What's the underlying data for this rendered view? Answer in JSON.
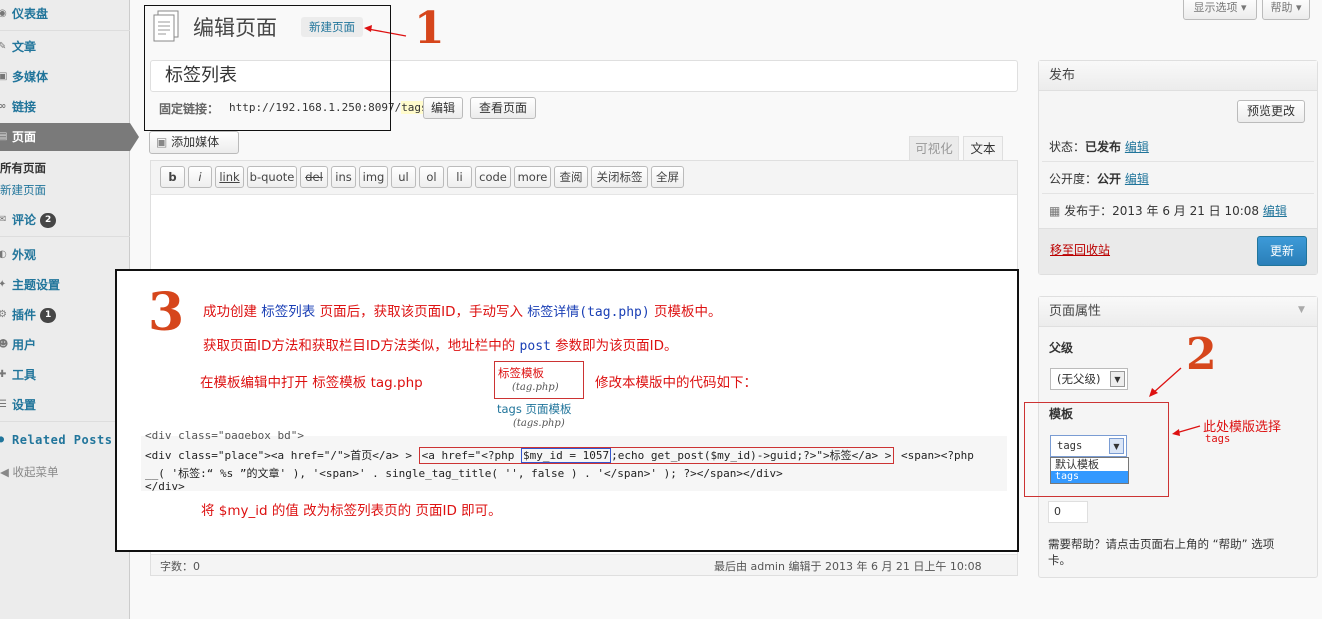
{
  "sidebar": {
    "items": [
      {
        "label": "仪表盘",
        "icon": "dashboard-icon"
      },
      {
        "label": "文章",
        "icon": "posts-icon"
      },
      {
        "label": "多媒体",
        "icon": "media-icon"
      },
      {
        "label": "链接",
        "icon": "links-icon"
      },
      {
        "label": "页面",
        "icon": "pages-icon"
      },
      {
        "label": "评论",
        "icon": "comments-icon",
        "badge": "2"
      },
      {
        "label": "外观",
        "icon": "appearance-icon"
      },
      {
        "label": "主题设置",
        "icon": "theme-settings-icon"
      },
      {
        "label": "插件",
        "icon": "plugins-icon",
        "badge": "1"
      },
      {
        "label": "用户",
        "icon": "users-icon"
      },
      {
        "label": "工具",
        "icon": "tools-icon"
      },
      {
        "label": "设置",
        "icon": "settings-icon"
      },
      {
        "label": "Related Posts",
        "icon": "related-posts-icon"
      }
    ],
    "submenu": [
      "所有页面",
      "新建页面"
    ],
    "collapse_label": "收起菜单"
  },
  "header": {
    "screen_options": "显示选项",
    "help": "帮助",
    "title": "编辑页面",
    "add_new": "新建页面"
  },
  "post": {
    "title": "标签列表",
    "permalink_label": "固定链接：",
    "permalink_url": "http://192.168.1.250:8097/",
    "permalink_slug": "tags",
    "permalink_tail": "/",
    "edit_button": "编辑",
    "view_button": "查看页面",
    "add_media": "添加媒体",
    "tab_visual": "可视化",
    "tab_text": "文本",
    "toolbar": [
      "b",
      "i",
      "link",
      "b-quote",
      "del",
      "ins",
      "img",
      "ul",
      "ol",
      "li",
      "code",
      "more",
      "查阅",
      "关闭标签",
      "全屏"
    ],
    "word_count": "字数：0",
    "last_edited": "最后由 admin 编辑于 2013 年 6 月 21 日上午 10:08"
  },
  "publish": {
    "title": "发布",
    "preview_button": "预览更改",
    "status_label": "状态：",
    "status_value": "已发布",
    "visibility_label": "公开度：",
    "visibility_value": "公开",
    "edit_link": "编辑",
    "published_on": "发布于：2013 年 6 月 21 日 10:08",
    "trash_link": "移至回收站",
    "update_button": "更新"
  },
  "page_attributes": {
    "title": "页面属性",
    "parent_label": "父级",
    "parent_value": "(无父级)",
    "template_label": "模板",
    "template_value": "tags",
    "template_options": [
      "默认模板",
      "tags"
    ],
    "order_value": "0",
    "help_text_1": "需要帮助？请点击页面右上角的 “帮助” 选项",
    "help_text_2": "卡。"
  },
  "annotations": {
    "num1": "1",
    "num2": "2",
    "num3": "3",
    "template_choice": "此处模版选择",
    "template_choice_sub": "tags",
    "line1_a": "成功创建 ",
    "line1_b": "标签列表",
    "line1_c": " 页面后，获取该页面ID，手动写入 ",
    "line1_d": "标签详情(tag.php)",
    "line1_e": " 页模板中。",
    "line2_a": "获取页面ID方法和获取栏目ID方法类似，地址栏中的 ",
    "line2_b": "post",
    "line2_c": " 参数即为该页面ID。",
    "line3_a": "在模板编辑中打开 标签模板 tag.php",
    "line3_b": "修改本模版中的代码如下：",
    "tpl_box_title": "标签模板",
    "tpl_box_sub": "(tag.php)",
    "tags_tpl_title": "tags 页面模板",
    "tags_tpl_sub": "(tags.php)",
    "code1": "<div class=\"pagebox_bd\">",
    "code2_a": "<div class=\"place\"><a href=\"/\">首页</a> > ",
    "code2_b": "<a href=\"<?php ",
    "code2_c": "$my_id = 1057",
    "code2_d": ";echo get_post($my_id)->guid;?>\">标签</a> >",
    "code2_e": " <span><?php",
    "code3": "__( '标签:“ %s ”的文章' ), '<span>' . single_tag_title( '', false ) . '</span>' ); ?></span></div>",
    "code4": "</div>",
    "final_note": "将 $my_id 的值 改为标签列表页的 页面ID 即可。"
  },
  "colors": {
    "accent": "#21759b",
    "annotation_red": "#d6461c",
    "update_button": "#2e8ac6"
  }
}
